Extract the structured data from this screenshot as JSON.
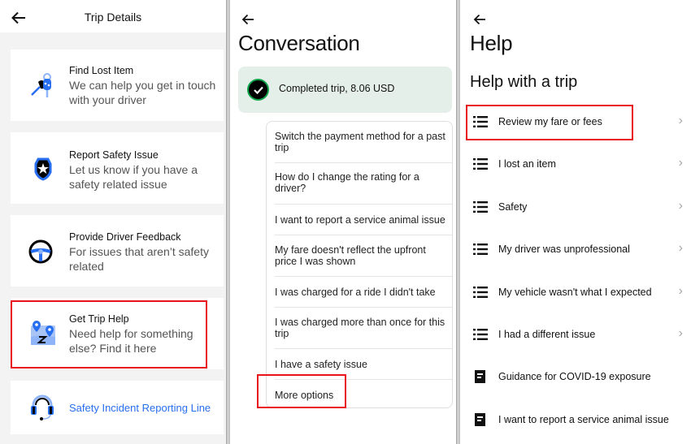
{
  "trip_details": {
    "title": "Trip Details",
    "cards": [
      {
        "icon": "keys-icon",
        "title": "Find Lost Item",
        "description": "We can help you get in touch with your driver"
      },
      {
        "icon": "shield-star-icon",
        "title": "Report Safety Issue",
        "description": "Let us know if you have a safety related issue"
      },
      {
        "icon": "steering-wheel-icon",
        "title": "Provide Driver Feedback",
        "description": "For issues that aren’t safety related"
      },
      {
        "icon": "map-pins-icon",
        "title": "Get Trip Help",
        "description": "Need help for something else? Find it here"
      },
      {
        "icon": "headset-icon",
        "link": "Safety Incident Reporting Line"
      }
    ]
  },
  "conversation": {
    "title": "Conversation",
    "trip_summary": "Completed trip, 8.06 USD",
    "options": [
      "Switch the payment method for a past trip",
      "How do I change the rating for a driver?",
      "I want to report a service animal issue",
      "My fare doesn't reflect the upfront price I was shown",
      "I was charged for a ride I didn't take",
      "I was charged more than once for this trip",
      "I have a safety issue",
      "More options"
    ]
  },
  "help": {
    "title": "Help",
    "subtitle": "Help with a trip",
    "items": [
      {
        "icon": "list-icon",
        "label": "Review my fare or fees",
        "chevron": "›"
      },
      {
        "icon": "list-icon",
        "label": "I lost an item",
        "chevron": "›"
      },
      {
        "icon": "list-icon",
        "label": "Safety",
        "chevron": "›"
      },
      {
        "icon": "list-icon",
        "label": "My driver was unprofessional",
        "chevron": "›"
      },
      {
        "icon": "list-icon",
        "label": "My vehicle wasn't what I expected",
        "chevron": "›"
      },
      {
        "icon": "list-icon",
        "label": "I had a different issue",
        "chevron": "›"
      },
      {
        "icon": "document-icon",
        "label": "Guidance for COVID-19 exposure"
      },
      {
        "icon": "document-icon",
        "label": "I want to report a service animal issue"
      }
    ]
  },
  "colors": {
    "accent_blue": "#276ef1",
    "highlight_red": "#e8131d",
    "trip_banner_bg": "#e5efea",
    "success_green": "#10a44a"
  }
}
